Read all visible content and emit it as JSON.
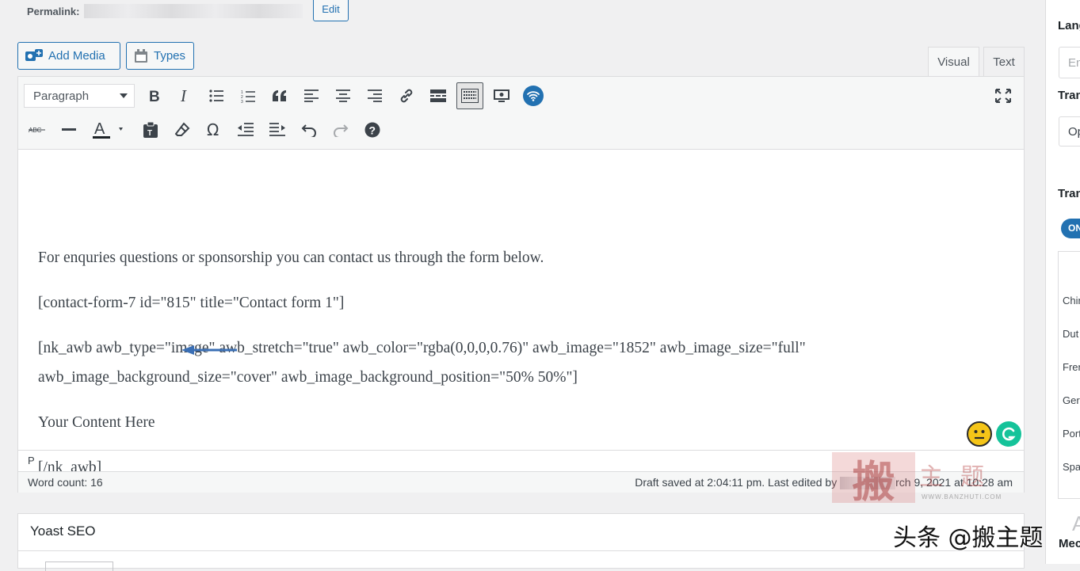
{
  "permalink": {
    "label": "Permalink:",
    "edit_button": "Edit"
  },
  "media_buttons": {
    "add_media": "Add Media",
    "types": "Types"
  },
  "editor_tabs": {
    "visual": "Visual",
    "text": "Text"
  },
  "toolbar": {
    "format_select": "Paragraph",
    "row1_icons": [
      "bold-icon",
      "italic-icon",
      "bullet-list-icon",
      "numbered-list-icon",
      "blockquote-icon",
      "align-left-icon",
      "align-center-icon",
      "align-right-icon",
      "link-icon",
      "read-more-icon",
      "toolbar-toggle-icon",
      "preview-icon",
      "wifi-plugin-icon",
      "fullscreen-icon"
    ],
    "row2_icons": [
      "strikethrough-icon",
      "horizontal-line-icon",
      "text-color-icon",
      "paste-text-icon",
      "clear-formatting-icon",
      "special-character-icon",
      "outdent-icon",
      "indent-icon",
      "undo-icon",
      "redo-icon",
      "help-icon"
    ],
    "accent_color": "#2271b1"
  },
  "content": {
    "p1": "For enquries questions or sponsorship you can contact us through the form below.",
    "p2": "[contact-form-7 id=\"815\" title=\"Contact form 1\"]",
    "p3a": "[nk_awb awb_type=\"image\" awb_stretch=\"true\" awb_color=\"rgba(0,0,0,0.76)\" awb_image=\"1852\" awb_image_size=\"full\"",
    "p3b": "awb_image_background_size=\"cover\" awb_image_background_position=\"50% 50%\"]",
    "p4": "Your Content Here",
    "p5": "[/nk_awb]"
  },
  "path_bar": "P",
  "status": {
    "word_count": "Word count: 16",
    "draft_saved_prefix": "Draft saved at 2:04:11 pm. Last edited by",
    "draft_saved_suffix": "rch 9, 2021 at 10:28 am"
  },
  "yoast": {
    "title": "Yoast SEO"
  },
  "sidebar": {
    "lang_label": "Lang",
    "lang_field": "En",
    "trans_label_1": "Tran",
    "trans_select": "Op",
    "trans_label_2": "Tran",
    "toggle": "ON",
    "languages": [
      "Chin",
      "Dut",
      "Fren",
      "Ger",
      "Port",
      "Spa"
    ],
    "bottom_letter": "A",
    "bottom_label": "Mec"
  },
  "watermarks": {
    "seal_char": "搬",
    "site_chars": "主题",
    "site_url": "WWW.BANZHUTI.COM",
    "toutiao": "头条 @搬主题"
  }
}
